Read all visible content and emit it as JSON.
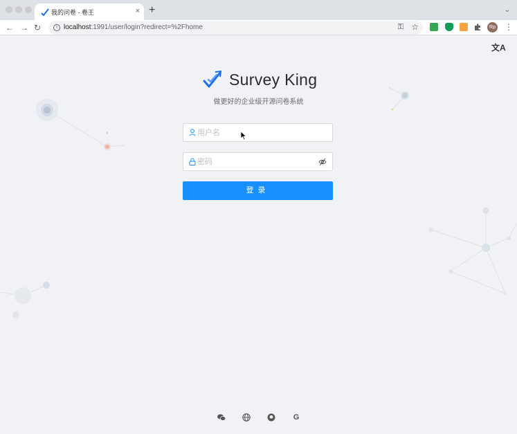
{
  "browser": {
    "tab_title": "我的问卷 - 卷王",
    "new_tab": "+",
    "close": "×",
    "tab_menu": "⌄",
    "url_host": "localhost",
    "url_rest": ":1991/user/login?redirect=%2Fhome",
    "avatar": "Rp",
    "icons": [
      "back-icon",
      "forward-icon",
      "reload-icon",
      "info-icon",
      "key-icon",
      "star-icon",
      "extensions-icon",
      "menu-icon"
    ]
  },
  "page": {
    "lang_icon": "文A",
    "brand_name": "Survey King",
    "subtitle": "做更好的企业级开源问卷系统",
    "username_placeholder": "用户名",
    "password_placeholder": "密码",
    "login_label": "登录",
    "footer_icons": [
      "wechat-icon",
      "globe-icon",
      "github-icon",
      "google-icon"
    ],
    "google_letter": "G"
  },
  "colors": {
    "primary": "#1890ff",
    "background": "#f0f2f5",
    "brand": "#1c6fe8"
  }
}
